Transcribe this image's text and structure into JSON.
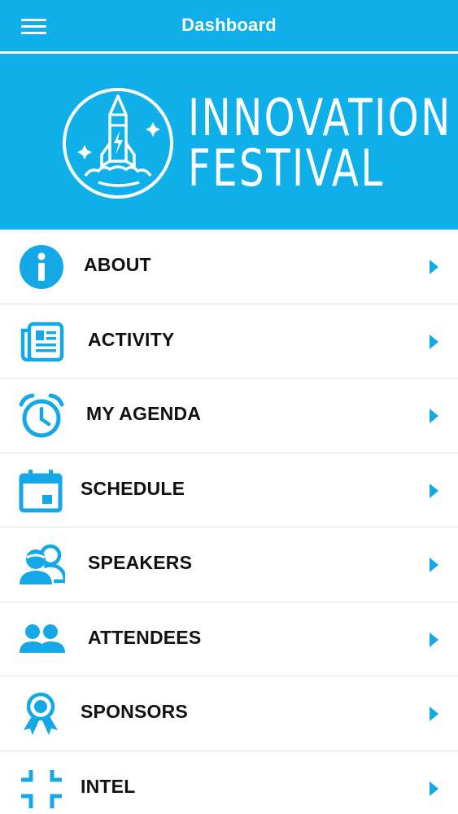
{
  "header": {
    "title": "Dashboard",
    "menu_icon": "hamburger-menu-icon",
    "accent_color": "#0fb0ea"
  },
  "banner": {
    "logo_icon": "rocket-logo-icon",
    "logo_line1": "INNOVATION",
    "logo_line2": "FESTIVAL"
  },
  "menu": {
    "items": [
      {
        "label": "ABOUT",
        "icon": "info-icon"
      },
      {
        "label": "ACTIVITY",
        "icon": "newspaper-icon"
      },
      {
        "label": "MY AGENDA",
        "icon": "alarm-clock-icon"
      },
      {
        "label": "SCHEDULE",
        "icon": "calendar-icon"
      },
      {
        "label": "SPEAKERS",
        "icon": "speakers-icon"
      },
      {
        "label": "ATTENDEES",
        "icon": "attendees-icon"
      },
      {
        "label": "SPONSORS",
        "icon": "award-ribbon-icon"
      },
      {
        "label": "INTEL",
        "icon": "collapse-corners-icon"
      }
    ],
    "item_icon_color": "#14a8e6",
    "chevron_icon": "chevron-right-icon"
  }
}
